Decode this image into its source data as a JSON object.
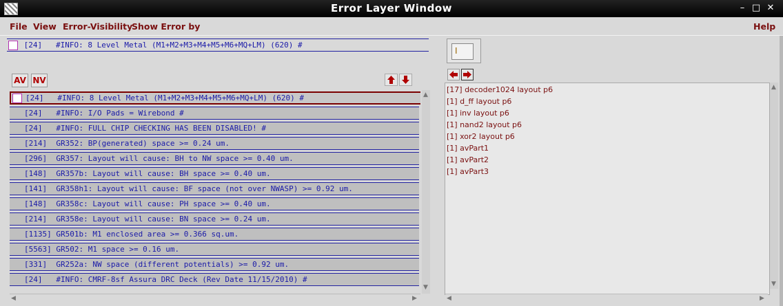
{
  "window": {
    "title": "Error Layer Window",
    "controls": {
      "minimize": "–",
      "maximize": "□",
      "close": "✕"
    }
  },
  "menu": [
    {
      "label": "File"
    },
    {
      "label": "View"
    },
    {
      "label": "Error-Visibility"
    },
    {
      "label": "Show Error by"
    },
    {
      "label": "Help"
    }
  ],
  "top_info": {
    "text": " [24]   #INFO: 8 Level Metal (M1+M2+M3+M4+M5+M6+MQ+LM) (620) #"
  },
  "buttons": {
    "av": "AV",
    "nv": "NV"
  },
  "errors": [
    {
      "text": "[24]   #INFO: 8 Level Metal (M1+M2+M3+M4+M5+M6+MQ+LM) (620) #",
      "selected": true
    },
    {
      "text": "[24]   #INFO: I/O Pads = Wirebond #"
    },
    {
      "text": "[24]   #INFO: FULL CHIP CHECKING HAS BEEN DISABLED! #"
    },
    {
      "text": "[214]  GR352: BP(generated) space >= 0.24 um."
    },
    {
      "text": "[296]  GR357: Layout will cause: BH to NW space >= 0.40 um."
    },
    {
      "text": "[148]  GR357b: Layout will cause: BH space >= 0.40 um."
    },
    {
      "text": "[141]  GR358h1: Layout will cause: BF space (not over NWASP) >= 0.92 um."
    },
    {
      "text": "[148]  GR358c: Layout will cause: PH space >= 0.40 um."
    },
    {
      "text": "[214]  GR358e: Layout will cause: BN space >= 0.24 um."
    },
    {
      "text": "[1135] GR501b: M1 enclosed area >= 0.366 sq.um."
    },
    {
      "text": "[5563] GR502: M1 space >= 0.16 um."
    },
    {
      "text": "[331]  GR252a: NW space (different potentials) >= 0.92 um."
    },
    {
      "text": "[24]   #INFO: CMRF-8sf Assura DRC Deck (Rev Date 11/15/2010) #"
    }
  ],
  "cells": [
    "[17] decoder1024 layout p6",
    "[1] d_ff layout p6",
    "[1] inv layout p6",
    "[1] nand2 layout p6",
    "[1] xor2 layout p6",
    "[1] avPart1",
    "[1] avPart2",
    "[1] avPart3"
  ],
  "colors": {
    "menu_text": "#7a1010",
    "error_text": "#1a1aa8",
    "row_border": "#2020a0",
    "selected_border": "#7a0000",
    "arrow_red": "#b00000"
  }
}
